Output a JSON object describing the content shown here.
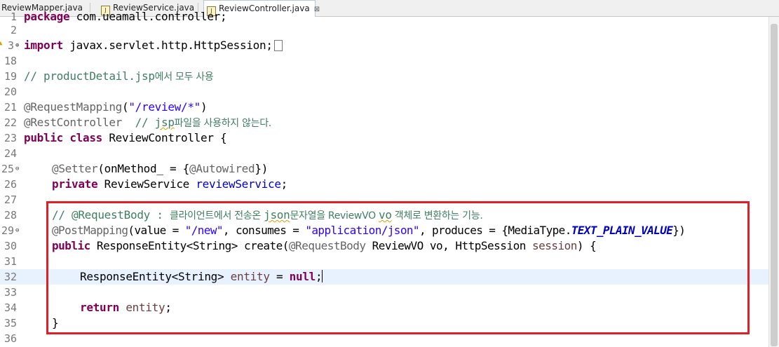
{
  "tabs": [
    {
      "label": "ReviewMapper.java",
      "active": false
    },
    {
      "label": "ReviewService.java",
      "active": false
    },
    {
      "label": "ReviewController.java",
      "active": true,
      "close": "⊠"
    }
  ],
  "lines": [
    {
      "num": "1",
      "text": "package com.ueamall.controller;"
    },
    {
      "num": "2",
      "text": ""
    },
    {
      "num": "3",
      "pre": "import",
      "text": " javax.servlet.http.HttpSession;"
    },
    {
      "num": "18",
      "text": ""
    },
    {
      "num": "19",
      "cmt_code": "// productDetail.jsp",
      "cmt_ko": "에서 모두 사용"
    },
    {
      "num": "20",
      "text": ""
    },
    {
      "num": "21",
      "ann": "@RequestMapping",
      "open": "(",
      "str": "\"/review/*\"",
      "close": ")"
    },
    {
      "num": "22",
      "ann": "@RestController",
      "cmt_a": "  // ",
      "cmt_jsp": "jsp",
      "cmt_ko": "파일을 사용하지 않는다."
    },
    {
      "num": "23",
      "kw1": "public",
      "kw2": "class",
      "text": " ReviewController {"
    },
    {
      "num": "24",
      "text": ""
    },
    {
      "num": "25",
      "ann": "@Setter",
      "mid": "(onMethod_ = {",
      "ann2": "@Autowired",
      "end": "})"
    },
    {
      "num": "26",
      "kw": "private",
      "type": " ReviewService ",
      "fld": "reviewService",
      "end": ";"
    },
    {
      "num": "27",
      "text": ""
    },
    {
      "num": "28",
      "c1": "// @RequestBody : ",
      "c2": "클라이언트에서 전송온 ",
      "c3": "json",
      "c4": "문자열을 ReviewVO ",
      "c5": "vo",
      "c6": " 객체로 변환하는 기능."
    },
    {
      "num": "29",
      "ann": "@PostMapping",
      "a": "(value = ",
      "s1": "\"/new\"",
      "b": ", consumes = ",
      "s2": "\"application/json\"",
      "c": ", produces = {MediaType.",
      "const": "TEXT_PLAIN_VALUE",
      "d": "})"
    },
    {
      "num": "30",
      "kw": "public",
      "a": " ResponseEntity<String> create(",
      "ann": "@RequestBody",
      "b": " ReviewVO vo, HttpSession ",
      "var": "session",
      "c": ") {"
    },
    {
      "num": "31",
      "text": ""
    },
    {
      "num": "32",
      "a": "ResponseEntity<String> ",
      "var": "entity",
      "b": " = ",
      "kw": "null",
      "c": ";"
    },
    {
      "num": "33",
      "text": ""
    },
    {
      "num": "34",
      "kw": "return",
      "var": " entity",
      "c": ";"
    },
    {
      "num": "35",
      "text": "}"
    },
    {
      "num": "36",
      "text": ""
    }
  ]
}
